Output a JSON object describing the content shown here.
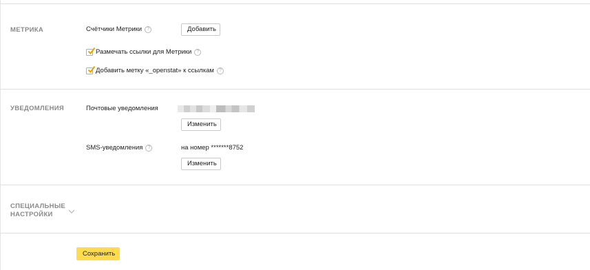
{
  "metrika": {
    "title": "МЕТРИКА",
    "counters_label": "Счётчики Метрики",
    "add_button": "Добавить",
    "mark_links_label": "Размечать ссылки для Метрики",
    "mark_links_checked": true,
    "openstat_label": "Добавить метку «_openstat» к ссылкам",
    "openstat_checked": true
  },
  "notifications": {
    "title": "УВЕДОМЛЕНИЯ",
    "email_label": "Почтовые уведомления",
    "email_change_button": "Изменить",
    "sms_label": "SMS-уведомления",
    "sms_value": "на номер *******8752",
    "sms_change_button": "Изменить"
  },
  "special": {
    "title_line1": "СПЕЦИАЛЬНЫЕ",
    "title_line2": "НАСТРОЙКИ"
  },
  "footer": {
    "save_button": "Сохранить"
  },
  "colors": {
    "save_button_bg": "#ffdb4d",
    "checkmark": "#e8a400",
    "section_title": "#8a8a8a",
    "divider": "#e0e0e0"
  },
  "icons": {
    "help": "question-circle-icon",
    "check": "checkmark-icon",
    "expand": "chevron-down-icon"
  }
}
